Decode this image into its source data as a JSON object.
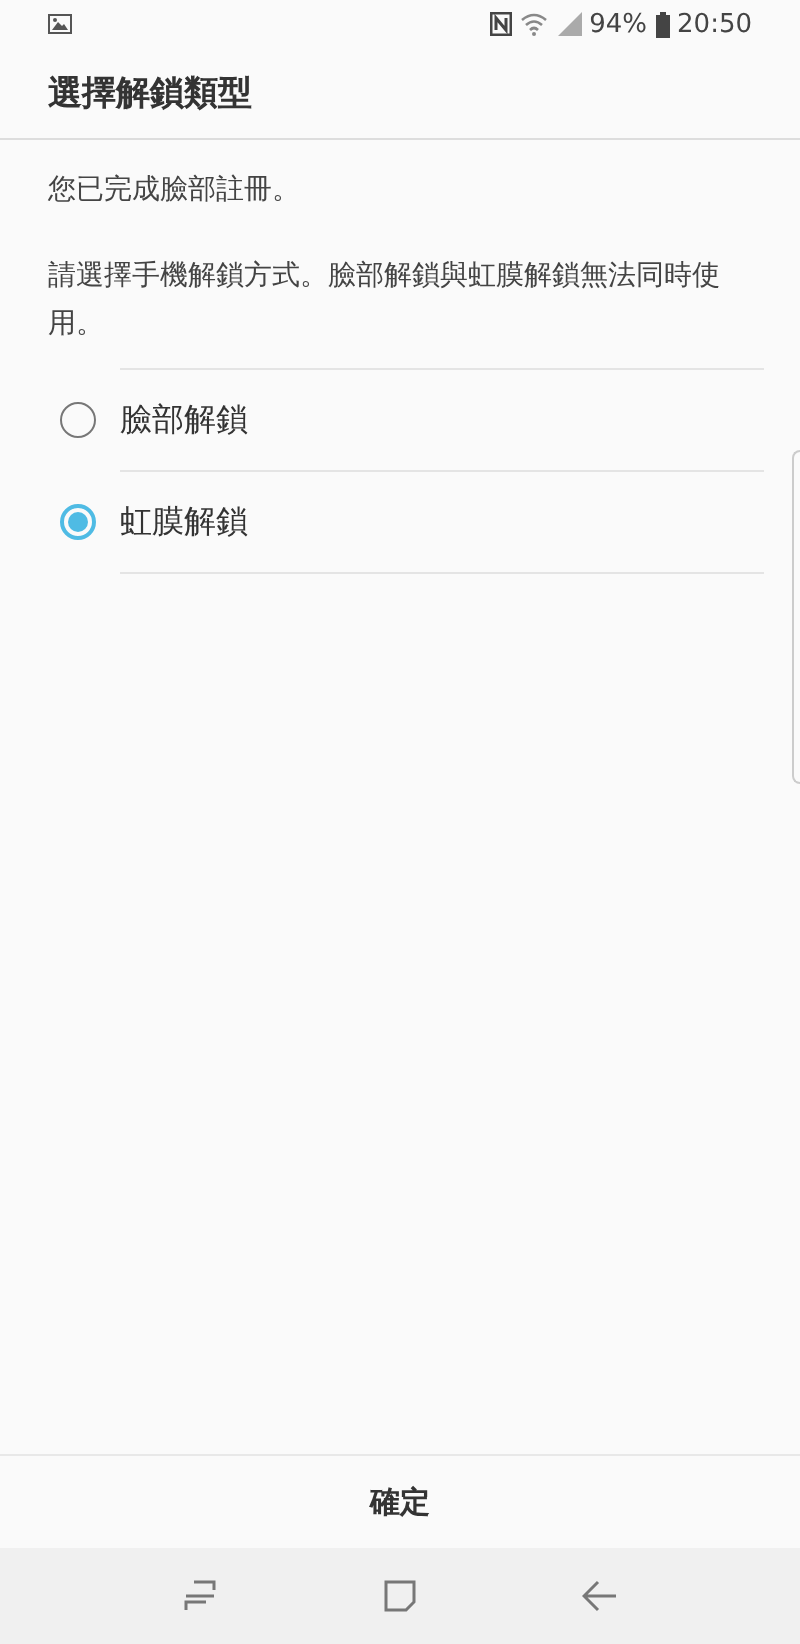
{
  "status_bar": {
    "battery": "94%",
    "time": "20:50"
  },
  "title": "選擇解鎖類型",
  "message": "您已完成臉部註冊。",
  "instruction": "請選擇手機解鎖方式。臉部解鎖與虹膜解鎖無法同時使用。",
  "options": [
    {
      "label": "臉部解鎖",
      "selected": false
    },
    {
      "label": "虹膜解鎖",
      "selected": true
    }
  ],
  "confirm_button": "確定"
}
